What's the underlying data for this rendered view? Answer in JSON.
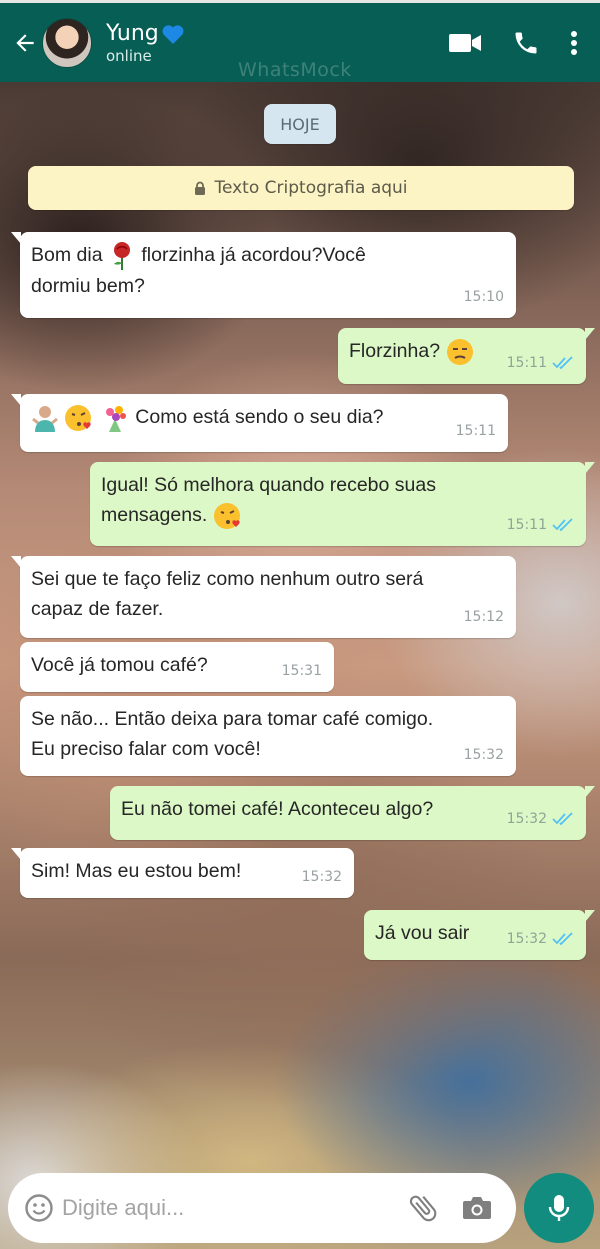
{
  "header": {
    "contact_name": "Yung",
    "status": "online",
    "watermark": "WhatsMock",
    "heart_icon": "blue-heart-icon"
  },
  "colors": {
    "header": "#075e54",
    "incoming_bubble": "#ffffff",
    "outgoing_bubble": "#dcf8c6",
    "read_ticks": "#4fc3f7",
    "mic_button": "#128c7e"
  },
  "chat": {
    "date_chip": "HOJE",
    "encryption_notice": "Texto Criptografia aqui",
    "messages": [
      {
        "dir": "in",
        "text_a": "Bom dia",
        "emoji": "rose-icon",
        "text_b": "florzinha já acordou?Você",
        "text_c": "dormiu bem?",
        "time": "15:10"
      },
      {
        "dir": "out",
        "text": "Florzinha?",
        "emoji": "unamused-face-icon",
        "time": "15:11",
        "status": "read"
      },
      {
        "dir": "in",
        "emojis": [
          "person-shrugging-icon",
          "face-blowing-kiss-icon",
          "bouquet-icon"
        ],
        "text": "Como está sendo o seu dia?",
        "time": "15:11"
      },
      {
        "dir": "out",
        "text_a": "Igual! Só melhora quando recebo suas",
        "text_b": "mensagens.",
        "emoji": "face-blowing-kiss-icon",
        "time": "15:11",
        "status": "read"
      },
      {
        "dir": "in",
        "text_a": "Sei que te faço feliz como nenhum outro será",
        "text_b": "capaz de fazer.",
        "time": "15:12"
      },
      {
        "dir": "in",
        "text": "Você já tomou café?",
        "time": "15:31"
      },
      {
        "dir": "in",
        "text_a": "Se não... Então deixa para tomar café comigo.",
        "text_b": "Eu preciso falar com você!",
        "time": "15:32"
      },
      {
        "dir": "out",
        "text": "Eu não tomei café! Aconteceu algo?",
        "time": "15:32",
        "status": "read"
      },
      {
        "dir": "in",
        "text": "Sim! Mas eu estou bem!",
        "time": "15:32"
      },
      {
        "dir": "out",
        "text": "Já vou sair",
        "time": "15:32",
        "status": "read"
      }
    ]
  },
  "input": {
    "placeholder": "Digite aqui..."
  },
  "icons": {
    "back": "arrow-left-icon",
    "video": "video-camera-icon",
    "call": "phone-icon",
    "menu": "more-vertical-icon",
    "lock": "lock-icon",
    "emoji": "smiley-icon",
    "attach": "paperclip-icon",
    "camera": "camera-icon",
    "mic": "microphone-icon"
  }
}
